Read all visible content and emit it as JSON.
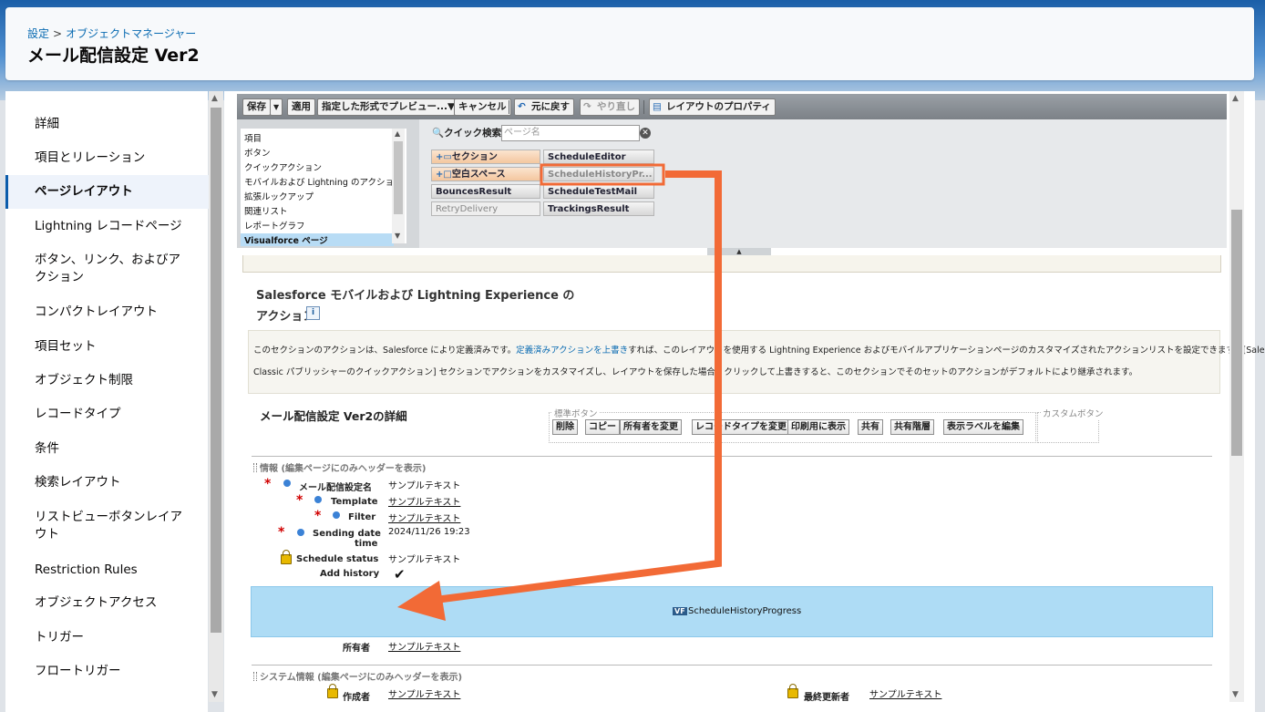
{
  "breadcrumb": {
    "parent": "設定",
    "separator": ">",
    "current": "オブジェクトマネージャー"
  },
  "page_title": "メール配信設定 Ver2",
  "sidebar": {
    "items": [
      {
        "label": "詳細"
      },
      {
        "label": "項目とリレーション"
      },
      {
        "label": "ページレイアウト",
        "active": true
      },
      {
        "label": "Lightning レコードページ"
      },
      {
        "label": "ボタン、リンク、およびア"
      },
      {
        "label": "クション"
      },
      {
        "label": "コンパクトレイアウト"
      },
      {
        "label": "項目セット"
      },
      {
        "label": "オブジェクト制限"
      },
      {
        "label": "レコードタイプ"
      },
      {
        "label": "条件"
      },
      {
        "label": "検索レイアウト"
      },
      {
        "label": "リストビューボタンレイア"
      },
      {
        "label": "ウト"
      },
      {
        "label": "Restriction Rules"
      },
      {
        "label": "オブジェクトアクセス"
      },
      {
        "label": "トリガー"
      },
      {
        "label": "フロートリガー"
      }
    ]
  },
  "toolbar": {
    "save": "保存",
    "save_menu": "▼",
    "apply": "適用",
    "preview": "指定した形式でプレビュー...▼",
    "cancel": "キャンセル",
    "undo": "元に戻す",
    "redo": "やり直し",
    "layout_properties": "レイアウトのプロパティ"
  },
  "palette": {
    "categories": [
      "項目",
      "ボタン",
      "クイックアクション",
      "モバイルおよび Lightning のアクション",
      "拡張ルックアップ",
      "関連リスト",
      "レポートグラフ",
      "Visualforce ページ"
    ],
    "selected_category": "Visualforce ページ",
    "quick_search_label": "クイック検索",
    "quick_search_placeholder": "ページ名",
    "items": [
      {
        "label": "セクション",
        "special": true
      },
      {
        "label": "ScheduleEditor"
      },
      {
        "label": "空白スペース",
        "special": true
      },
      {
        "label": "ScheduleHistoryPr...",
        "disabled": true
      },
      {
        "label": "BouncesResult"
      },
      {
        "label": "ScheduleTestMail"
      },
      {
        "label": "RetryDelivery",
        "disabled": true
      },
      {
        "label": "TrackingsResult"
      }
    ]
  },
  "actions_section": {
    "title_line1": "Salesforce モバイルおよび Lightning Experience の",
    "title_line2": "アクション",
    "info_icon": "i"
  },
  "notice": {
    "line1_pre": "このセクションのアクションは、Salesforce により定義済みです。",
    "line1_link": "定義済みアクションを上書き",
    "line1_post": "すれば、このレイアウトを使用する Lightning Experience およびモバイルアプリケーションページのカスタマイズされたアクションリストを設定できます。[Salesforce",
    "line2": "Classic パブリッシャーのクイックアクション] セクションでアクションをカスタマイズし、レイアウトを保存した場合、クリックして上書きすると、このセクションでそのセットのアクションがデフォルトにより継承されます。"
  },
  "detail": {
    "title": "メール配信設定 Ver2の詳細",
    "standard_buttons_label": "標準ボタン",
    "custom_buttons_label": "カスタムボタン",
    "standard_buttons": [
      "削除",
      "コピー",
      "所有者を変更",
      "レコードタイプを変更",
      "印刷用に表示",
      "共有",
      "共有階層",
      "表示ラベルを編集"
    ]
  },
  "info_section": {
    "header": "情報 (編集ページにのみヘッダーを表示)",
    "fields": [
      {
        "label": "メール配信設定名",
        "value": "サンプルテキスト",
        "required": true,
        "underline": false
      },
      {
        "label": "Template",
        "value": "サンプルテキスト",
        "required": true,
        "underline": true
      },
      {
        "label": "Filter",
        "value": "サンプルテキスト",
        "required": true,
        "underline": true
      },
      {
        "label": "Sending date",
        "label2": "time",
        "value": "2024/11/26 19:23",
        "required": true,
        "underline": false
      },
      {
        "label": "Schedule status",
        "value": "サンプルテキスト",
        "locked": true,
        "underline": false
      },
      {
        "label": "Add history",
        "value": "✔"
      }
    ],
    "visualforce_tag": "VF",
    "visualforce_page": "ScheduleHistoryProgress",
    "owner_label": "所有者",
    "owner_value": "サンプルテキスト"
  },
  "system_section": {
    "header": "システム情報 (編集ページにのみヘッダーを表示)",
    "created_by_label": "作成者",
    "created_by_value": "サンプルテキスト",
    "modified_by_label": "最終更新者",
    "modified_by_value": "サンプルテキスト"
  },
  "annotation": {
    "arrow_color": "#f26a36",
    "highlight_color": "#f26a36"
  }
}
